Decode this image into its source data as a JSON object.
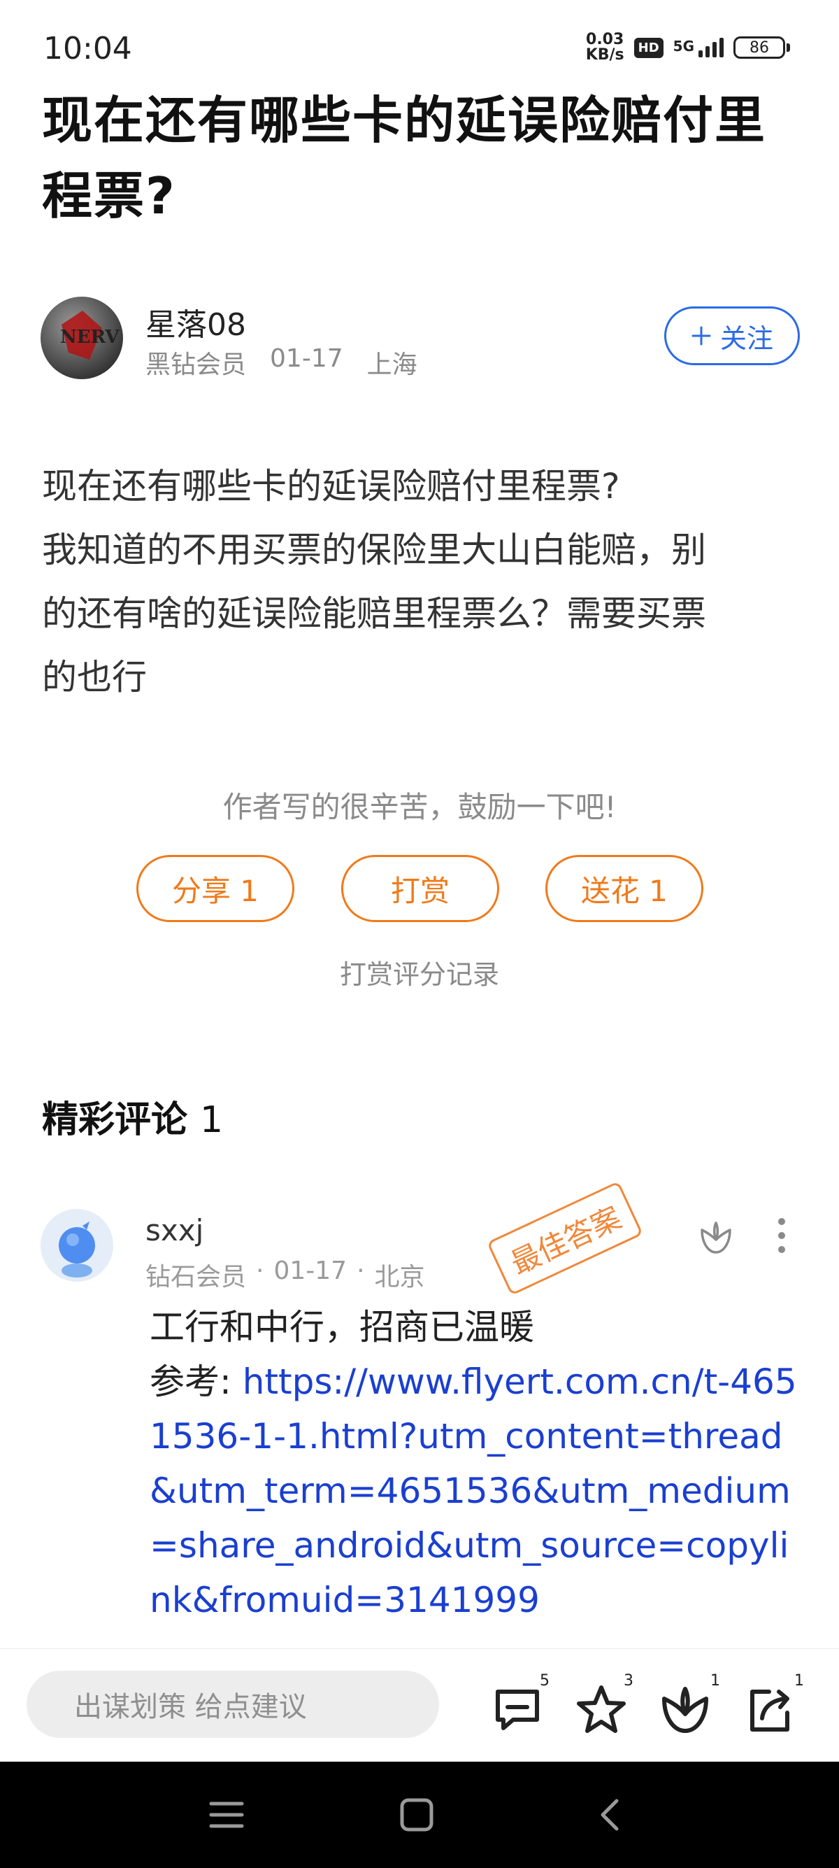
{
  "status_bar": {
    "time": "10:04",
    "net_speed_value": "0.03",
    "net_speed_unit": "KB/s",
    "hd_label": "HD",
    "network": "5G",
    "battery": "86"
  },
  "post": {
    "title": "现在还有哪些卡的延误险赔付里程票?",
    "author": {
      "name": "星落08",
      "level": "黑钻会员",
      "date": "01-17",
      "location": "上海"
    },
    "follow_label": "关注",
    "body_lines": [
      "现在还有哪些卡的延误险赔付里程票?",
      "我知道的不用买票的保险里大山白能赔，别",
      "的还有啥的延误险能赔里程票么？需要买票",
      "的也行"
    ],
    "encourage_text": "作者写的很辛苦，鼓励一下吧!",
    "actions": {
      "share": "分享 1",
      "reward": "打赏",
      "flower": "送花 1"
    },
    "reward_record_label": "打赏评分记录"
  },
  "comments": {
    "heading": "精彩评论",
    "count": "1",
    "items": [
      {
        "name": "sxxj",
        "level": "钻石会员",
        "date": "01-17",
        "location": "北京",
        "badge": "最佳答案",
        "text": "工行和中行，招商已温暖",
        "ref_label": "参考: ",
        "link": "https://www.flyert.com.cn/t-4651536-1-1.html?utm_content=thread&utm_term=4651536&utm_medium=share_android&utm_source=copylink&fromuid=3141999"
      }
    ]
  },
  "bottom_bar": {
    "input_placeholder": "出谋划策 给点建议",
    "comment_count": "5",
    "favorite_count": "3",
    "flower_count": "1",
    "share_count": "1"
  }
}
